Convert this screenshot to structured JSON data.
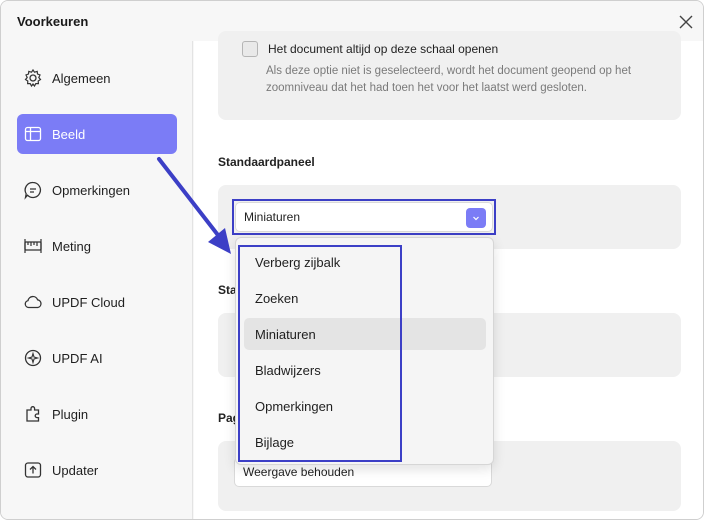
{
  "window": {
    "title": "Voorkeuren",
    "close_icon": "close-icon"
  },
  "sidebar": {
    "items": [
      {
        "label": "Algemeen",
        "icon": "gear-icon",
        "active": false
      },
      {
        "label": "Beeld",
        "icon": "layout-icon",
        "active": true
      },
      {
        "label": "Opmerkingen",
        "icon": "comment-icon",
        "active": false
      },
      {
        "label": "Meting",
        "icon": "ruler-icon",
        "active": false
      },
      {
        "label": "UPDF Cloud",
        "icon": "cloud-icon",
        "active": false
      },
      {
        "label": "UPDF AI",
        "icon": "ai-sparkle-icon",
        "active": false
      },
      {
        "label": "Plugin",
        "icon": "plugin-icon",
        "active": false
      },
      {
        "label": "Updater",
        "icon": "update-icon",
        "active": false
      }
    ]
  },
  "main": {
    "zoom_option": {
      "checkbox_label": "Het document altijd op deze schaal openen",
      "checked": false,
      "help_text": "Als deze optie niet is geselecteerd, wordt het document geopend op het zoomniveau dat het had toen het voor het laatst werd gesloten."
    },
    "default_panel": {
      "label": "Standaardpaneel",
      "selected": "Miniaturen",
      "options": [
        "Verberg zijbalk",
        "Zoeken",
        "Miniaturen",
        "Bladwijzers",
        "Opmerkingen",
        "Bijlage"
      ]
    },
    "second_section": {
      "label_fragment": "Sta"
    },
    "third_section": {
      "label_fragment": "Pag",
      "selected": "Weergave behouden"
    }
  },
  "colors": {
    "accent": "#7b7cf6",
    "annotation": "#3c3fc6"
  }
}
